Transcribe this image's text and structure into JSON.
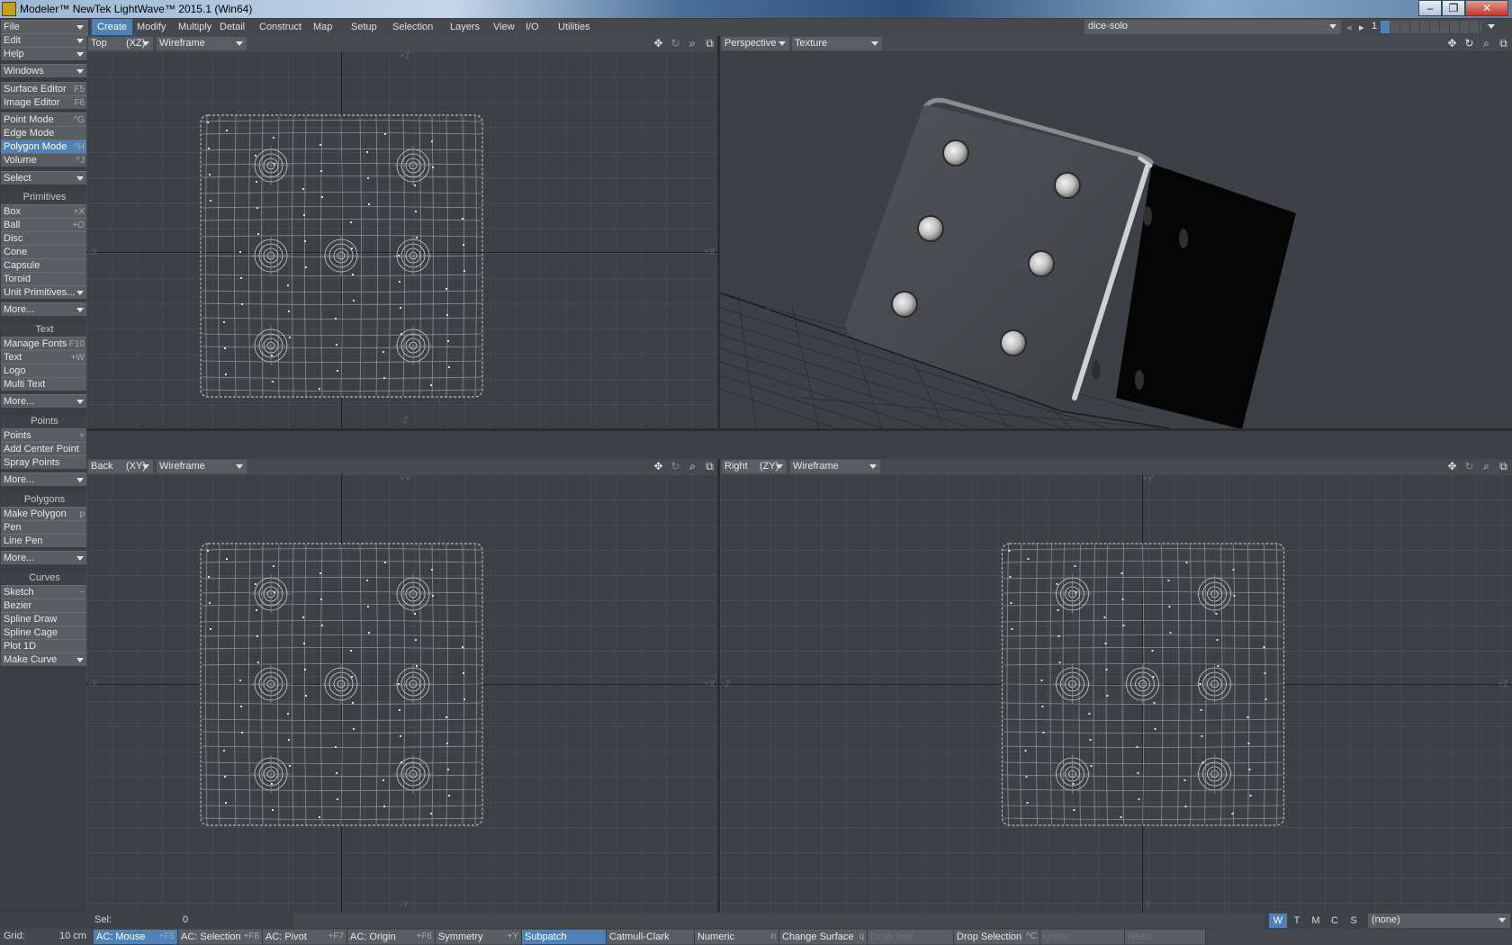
{
  "window": {
    "title": "Modeler™ NewTek LightWave™ 2015.1 (Win64)",
    "minimize": "–",
    "restore": "❐",
    "close": "✕"
  },
  "menu_tabs": [
    {
      "label": "Create",
      "active": true
    },
    {
      "label": "Modify"
    },
    {
      "label": "Multiply"
    },
    {
      "label": "Detail"
    },
    {
      "label": "Construct"
    },
    {
      "label": "Map"
    },
    {
      "label": "Setup"
    },
    {
      "label": "Selection"
    },
    {
      "label": "Layers"
    },
    {
      "label": "View"
    },
    {
      "label": "I/O"
    },
    {
      "label": "Utilities"
    }
  ],
  "object_selector": {
    "value": "dice-solo",
    "layer": "1"
  },
  "sidebar": {
    "top": [
      {
        "label": "File",
        "dropdown": true
      },
      {
        "label": "Edit",
        "dropdown": true
      },
      {
        "label": "Help",
        "dropdown": true
      },
      {
        "label": "Windows",
        "dropdown": true
      },
      {
        "label": "Surface Editor",
        "shortcut": "F5"
      },
      {
        "label": "Image Editor",
        "shortcut": "F6"
      },
      {
        "label": "Point Mode",
        "shortcut": "^G"
      },
      {
        "label": "Edge Mode",
        "shortcut": ""
      },
      {
        "label": "Polygon Mode",
        "shortcut": "^H",
        "selected": true
      },
      {
        "label": "Volume",
        "shortcut": "^J"
      },
      {
        "label": "Select",
        "dropdown": true
      }
    ],
    "primitives_header": "Primitives",
    "primitives": [
      {
        "label": "Box",
        "shortcut": "+X"
      },
      {
        "label": "Ball",
        "shortcut": "+O"
      },
      {
        "label": "Disc",
        "shortcut": ""
      },
      {
        "label": "Cone",
        "shortcut": ""
      },
      {
        "label": "Capsule",
        "shortcut": ""
      },
      {
        "label": "Toroid",
        "shortcut": ""
      },
      {
        "label": "Unit Primitives...",
        "dropdown": true
      },
      {
        "label": "More...",
        "dropdown": true
      }
    ],
    "text_header": "Text",
    "text": [
      {
        "label": "Manage Fonts",
        "shortcut": "F10"
      },
      {
        "label": "Text",
        "shortcut": "+W"
      },
      {
        "label": "Logo",
        "shortcut": ""
      },
      {
        "label": "Multi Text",
        "shortcut": ""
      },
      {
        "label": "More...",
        "dropdown": true
      }
    ],
    "points_header": "Points",
    "points": [
      {
        "label": "Points",
        "shortcut": "+"
      },
      {
        "label": "Add Center Point",
        "shortcut": ""
      },
      {
        "label": "Spray Points",
        "shortcut": ""
      },
      {
        "label": "More...",
        "dropdown": true
      }
    ],
    "polygons_header": "Polygons",
    "polygons": [
      {
        "label": "Make Polygon",
        "shortcut": "p"
      },
      {
        "label": "Pen",
        "shortcut": ""
      },
      {
        "label": "Line Pen",
        "shortcut": ""
      },
      {
        "label": "More...",
        "dropdown": true
      }
    ],
    "curves_header": "Curves",
    "curves": [
      {
        "label": "Sketch",
        "shortcut": "~"
      },
      {
        "label": "Bezier",
        "shortcut": ""
      },
      {
        "label": "Spline Draw",
        "shortcut": ""
      },
      {
        "label": "Spline Cage",
        "shortcut": ""
      },
      {
        "label": "Plot 1D",
        "shortcut": ""
      },
      {
        "label": "Make Curve",
        "dropdown": true
      }
    ]
  },
  "viewports": {
    "top": {
      "view": "Top",
      "axis": "(XZ)",
      "mode": "Wireframe",
      "labels": {
        "top": "+Z",
        "bottom": "-Z",
        "left": "-X",
        "right": "+X"
      }
    },
    "perspective": {
      "view": "Perspective",
      "mode": "Texture",
      "labels": {
        "floor_z": "+Z",
        "floor_x": "-X"
      }
    },
    "back": {
      "view": "Back",
      "axis": "(XY)",
      "mode": "Wireframe",
      "labels": {
        "top": "+Y",
        "bottom": "-Y",
        "left": "-X",
        "right": "+X"
      }
    },
    "right": {
      "view": "Right",
      "axis": "(ZY)",
      "mode": "Wireframe",
      "labels": {
        "top": "+Y",
        "bottom": "-Y",
        "left": "-Z",
        "right": "+Z"
      }
    }
  },
  "status": {
    "sel_label": "Sel:",
    "sel_value": "0",
    "wtmcs": [
      "W",
      "T",
      "M",
      "C",
      "S"
    ],
    "wtmcs_active": "W",
    "surface": "(none)"
  },
  "bottombar": {
    "grid_label": "Grid:",
    "grid_value": "10 cm",
    "buttons": [
      {
        "label": "AC: Mouse",
        "shortcut": "+F5",
        "active": true
      },
      {
        "label": "AC: Selection",
        "shortcut": "+F8"
      },
      {
        "label": "AC: Pivot",
        "shortcut": "+F7"
      },
      {
        "label": "AC: Origin",
        "shortcut": "+F6"
      },
      {
        "label": "Symmetry",
        "shortcut": "+Y"
      },
      {
        "label": "Subpatch",
        "shortcut": "",
        "active": true
      },
      {
        "label": "Catmull-Clark",
        "shortcut": ""
      },
      {
        "label": "Numeric",
        "shortcut": "n"
      },
      {
        "label": "Change Surface",
        "shortcut": "q"
      },
      {
        "label": "Drop Tool",
        "shortcut": "",
        "disabled": true
      },
      {
        "label": "Drop Selection",
        "shortcut": "^C"
      },
      {
        "label": "Undo",
        "shortcut": "",
        "disabled": true
      },
      {
        "label": "Redo",
        "shortcut": "",
        "disabled": true
      }
    ]
  },
  "colors": {
    "accent": "#4f83b8",
    "background": "#3d4045",
    "panel": "#5a5d62"
  },
  "icons": {
    "move": "move-icon",
    "rotate": "rotate-icon",
    "zoom": "zoom-icon",
    "maximize": "maximize-icon"
  }
}
